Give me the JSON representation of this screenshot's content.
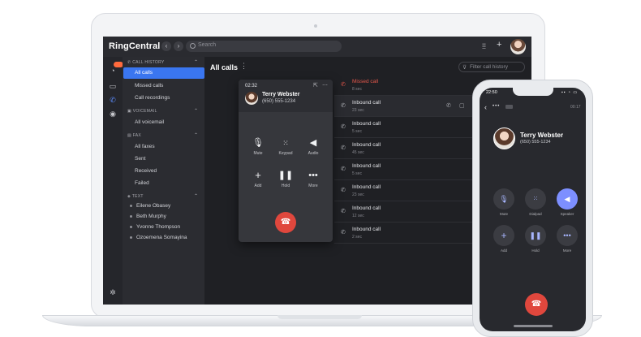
{
  "app": {
    "name": "RingCentral"
  },
  "search": {
    "placeholder": "Search"
  },
  "rail": {
    "badge": ""
  },
  "sidebar": {
    "call_history_header": "CALL HISTORY",
    "call_history_items": [
      "All calls",
      "Missed calls",
      "Call recordings"
    ],
    "voicemail_header": "VOICEMAIL",
    "voicemail_items": [
      "All voicemail"
    ],
    "fax_header": "FAX",
    "fax_items": [
      "All faxes",
      "Sent",
      "Received",
      "Failed"
    ],
    "text_header": "TEXT",
    "text_items": [
      "Eilene Obasey",
      "Beth Murphy",
      "Yvonne Thompson",
      "Ozoemena Somayina"
    ]
  },
  "main": {
    "title": "All calls",
    "more": "⋮",
    "filter_placeholder": "Filter call history",
    "calls": [
      {
        "type": "Missed call",
        "time": "8 sec",
        "missed": true
      },
      {
        "type": "Inbound call",
        "time": "23 sec",
        "missed": false
      },
      {
        "type": "Inbound call",
        "time": "5 sec",
        "missed": false
      },
      {
        "type": "Inbound call",
        "time": "45 sec",
        "missed": false
      },
      {
        "type": "Inbound call",
        "time": "5 sec",
        "missed": false
      },
      {
        "type": "Inbound call",
        "time": "23 sec",
        "missed": false
      },
      {
        "type": "Inbound call",
        "time": "12 sec",
        "missed": false
      },
      {
        "type": "Inbound call",
        "time": "2 sec",
        "missed": false
      }
    ]
  },
  "popup": {
    "timer": "02:32",
    "contact_name": "Terry Webster",
    "contact_phone": "(650) 555-1234",
    "buttons": [
      {
        "label": "Mute",
        "icon": "microphone-icon"
      },
      {
        "label": "Keypad",
        "icon": "keypad-icon"
      },
      {
        "label": "Audio",
        "icon": "speaker-icon"
      },
      {
        "label": "Add",
        "icon": "plus-icon"
      },
      {
        "label": "Hold",
        "icon": "pause-icon"
      },
      {
        "label": "More",
        "icon": "more-dots-icon"
      }
    ]
  },
  "phone": {
    "status_time": "22:50",
    "status_icons": "▪▪ ◔ ▭",
    "timer": "00:17",
    "contact_name": "Terry Webster",
    "contact_phone": "(650) 555-1234",
    "buttons": [
      {
        "label": "Mute",
        "icon": "microphone-icon",
        "active": false
      },
      {
        "label": "Dialpad",
        "icon": "keypad-icon",
        "active": false
      },
      {
        "label": "Speaker",
        "icon": "speaker-icon",
        "active": true
      },
      {
        "label": "Add",
        "icon": "plus-icon",
        "active": false
      },
      {
        "label": "Hold",
        "icon": "pause-icon",
        "active": false
      },
      {
        "label": "More",
        "icon": "more-dots-icon",
        "active": false
      }
    ]
  },
  "colors": {
    "accent": "#3a76f0",
    "hangup": "#e0473d",
    "missed": "#e5574b",
    "speaker_active": "#7d8fff"
  }
}
